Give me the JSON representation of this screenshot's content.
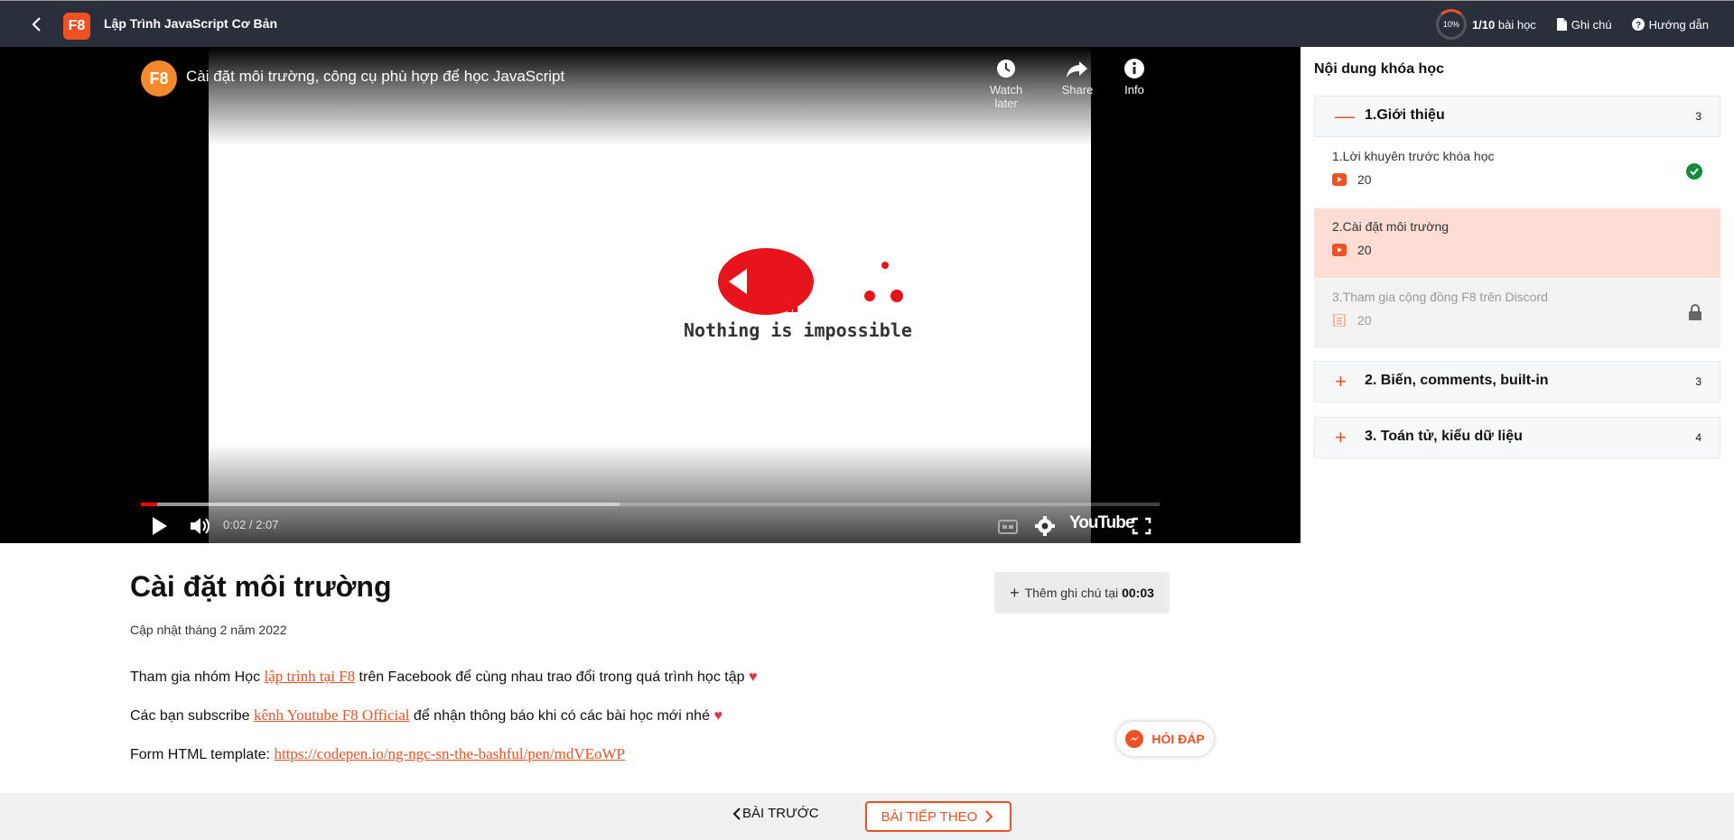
{
  "header": {
    "logo": "F8",
    "course_title": "Lập Trình JavaScript Cơ Bản",
    "progress_percent": "10%",
    "lessons_done": "1/10",
    "lessons_suffix": "bài học",
    "notes_label": "Ghi chú",
    "guide_label": "Hướng dẫn"
  },
  "video": {
    "channel_logo": "F8",
    "title": "Cài đặt môi trường, công cụ phù hợp để học JavaScript",
    "watch_later": "Watch later",
    "share": "Share",
    "info": "Info",
    "slogan": "Nothing is impossible",
    "time": "0:02 / 2:07",
    "youtube_label": "YouTube",
    "played_fraction": 0.016,
    "buffered_fraction": 0.47
  },
  "sidebar": {
    "heading": "Nội dung khóa học",
    "sections": [
      {
        "sign": "—",
        "name": "1.Giới thiệu",
        "count": "3"
      },
      {
        "sign": "+",
        "name": "2. Biến, comments, built-in",
        "count": "3"
      },
      {
        "sign": "+",
        "name": "3. Toán tử, kiểu dữ liệu",
        "count": "4"
      }
    ],
    "lessons": [
      {
        "name": "1.Lời khuyên trước khóa học",
        "meta": "20",
        "status": "completed"
      },
      {
        "name": "2.Cài đặt môi trường",
        "meta": "20",
        "status": "active"
      },
      {
        "name": "3.Tham gia cộng đồng F8 trên Discord",
        "meta": "20",
        "status": "locked"
      }
    ]
  },
  "content": {
    "title": "Cài đặt môi trường",
    "updated": "Cập nhật tháng 2 năm 2022",
    "add_note_label": "Thêm ghi chú tại",
    "add_note_time": "00:03",
    "p1_before": "Tham gia nhóm Học ",
    "p1_link": "lập trình tại F8",
    "p1_after": " trên Facebook để cùng nhau trao đổi trong quá trình học tập",
    "p2_before": "Các bạn subscribe ",
    "p2_link": "kênh Youtube F8 Official",
    "p2_after": " để nhận thông báo khi có các bài học mới nhé",
    "p3_before": "Form HTML template: ",
    "p3_link": "https://codepen.io/ng-ngc-sn-the-bashful/pen/mdVEoWP",
    "heart": "♥",
    "qa_label": "HỎI ĐÁP"
  },
  "footer": {
    "prev_label": "BÀI TRƯỚC",
    "next_label": "BÀI TIẾP THEO"
  },
  "colors": {
    "accent": "#f05123",
    "topbar": "#292f3b",
    "active_lesson_bg": "#fcdcd3",
    "locked_lesson_bg": "#f2f2f2",
    "completed": "#148a3c"
  }
}
